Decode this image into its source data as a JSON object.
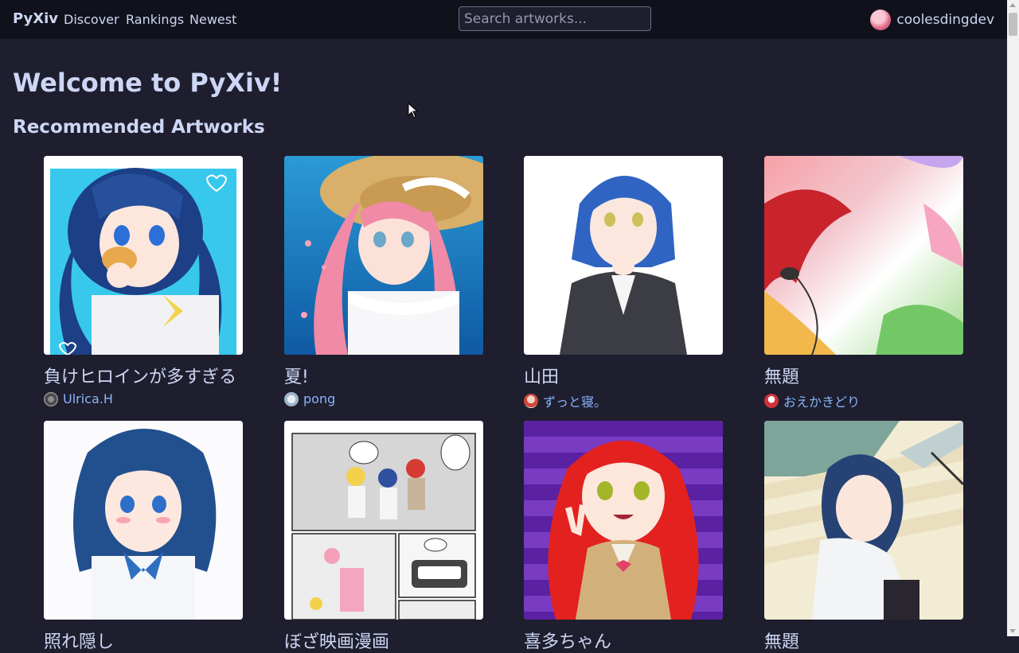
{
  "nav": {
    "brand": "PyXiv",
    "links": [
      "Discover",
      "Rankings",
      "Newest"
    ],
    "search_placeholder": "Search artworks...",
    "username": "coolesdingdev"
  },
  "page": {
    "welcome": "Welcome to PyXiv!",
    "section_title": "Recommended Artworks"
  },
  "artworks": [
    {
      "title": "負けヒロインが多すぎる",
      "author": "Ulrica.H"
    },
    {
      "title": "夏!",
      "author": "pong"
    },
    {
      "title": "山田",
      "author": "ずっと寝。"
    },
    {
      "title": "無題",
      "author": "おえかきどり"
    },
    {
      "title": "照れ隠し",
      "author": ""
    },
    {
      "title": "ぼざ映画漫画",
      "author": ""
    },
    {
      "title": "喜多ちゃん",
      "author": ""
    },
    {
      "title": "無題",
      "author": ""
    }
  ]
}
